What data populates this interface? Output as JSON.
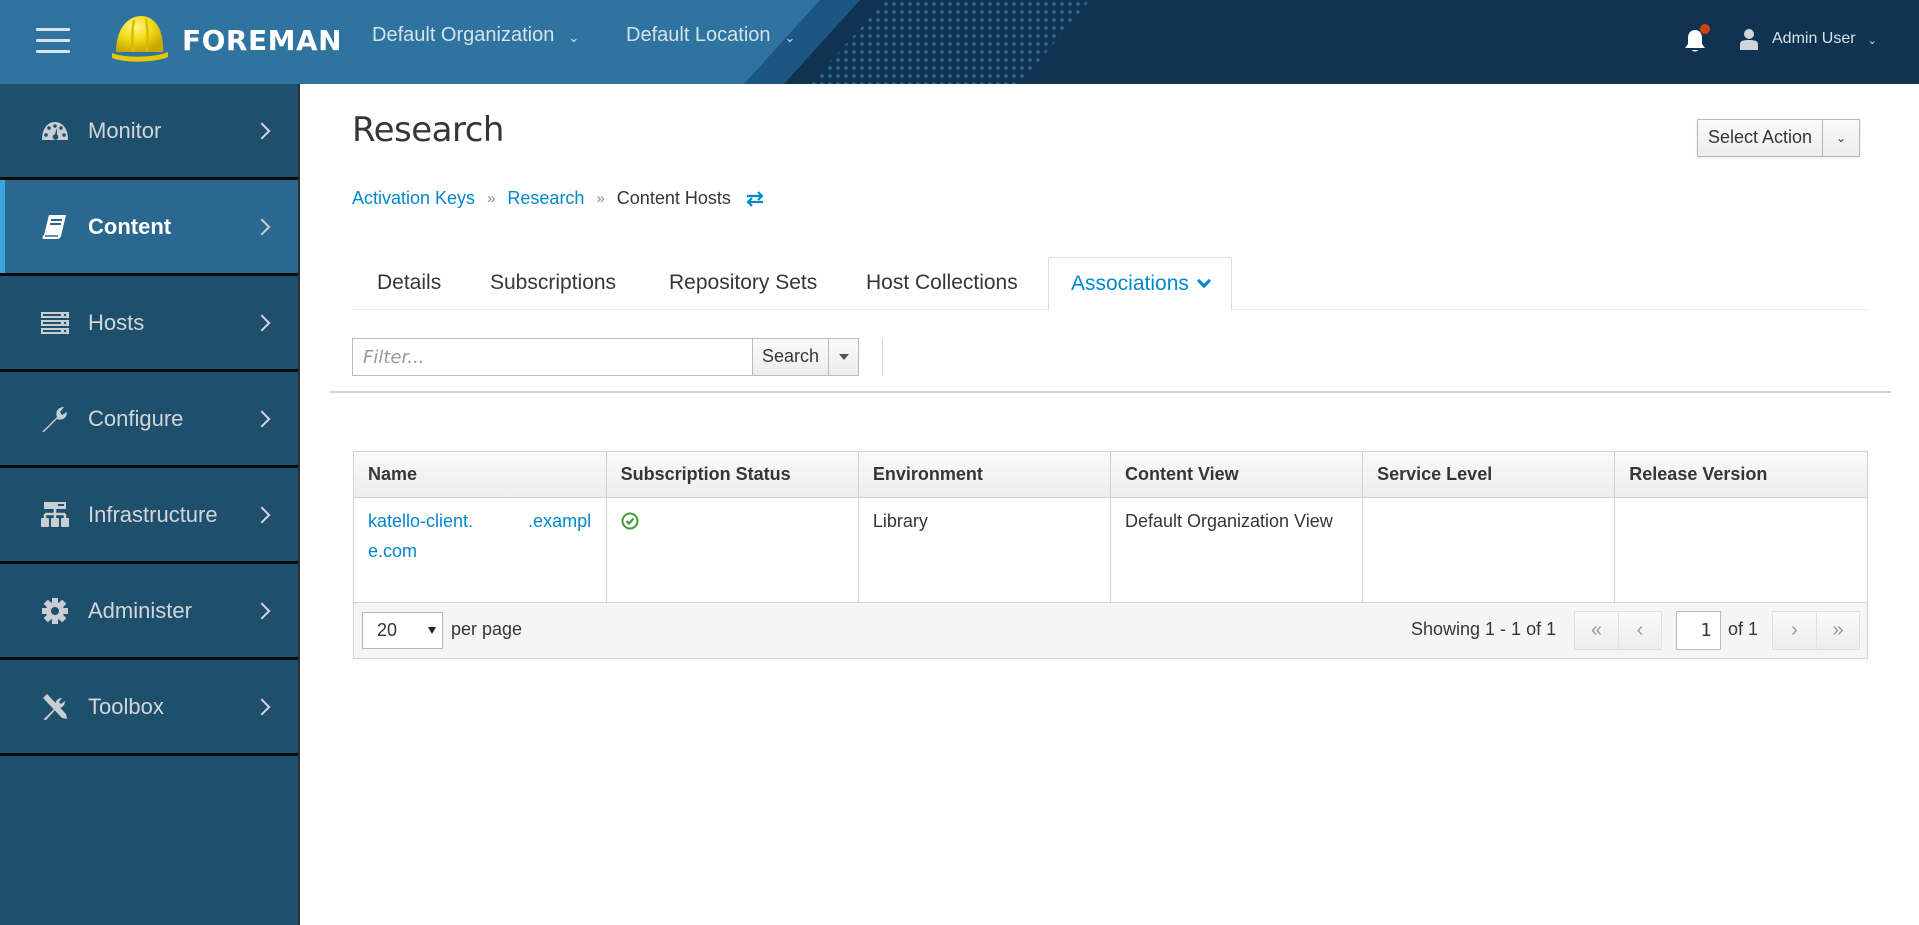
{
  "header": {
    "brand": "FOREMAN",
    "organization": "Default Organization",
    "location": "Default Location",
    "user": "Admin User",
    "notification_badge_color": "#d0450d"
  },
  "sidebar": {
    "items": [
      {
        "label": "Monitor",
        "icon": "dashboard-icon",
        "active": false
      },
      {
        "label": "Content",
        "icon": "book-icon",
        "active": true
      },
      {
        "label": "Hosts",
        "icon": "server-icon",
        "active": false
      },
      {
        "label": "Configure",
        "icon": "wrench-icon",
        "active": false
      },
      {
        "label": "Infrastructure",
        "icon": "network-icon",
        "active": false
      },
      {
        "label": "Administer",
        "icon": "gear-icon",
        "active": false
      },
      {
        "label": "Toolbox",
        "icon": "tools-icon",
        "active": false
      }
    ]
  },
  "page": {
    "title": "Research",
    "select_action": "Select Action",
    "breadcrumb": [
      {
        "label": "Activation Keys",
        "link": true
      },
      {
        "label": "Research",
        "link": true
      },
      {
        "label": "Content Hosts",
        "link": false
      }
    ],
    "tabs": [
      {
        "label": "Details",
        "active": false
      },
      {
        "label": "Subscriptions",
        "active": false
      },
      {
        "label": "Repository Sets",
        "active": false
      },
      {
        "label": "Host Collections",
        "active": false
      },
      {
        "label": "Associations",
        "active": true
      }
    ]
  },
  "search": {
    "placeholder": "Filter...",
    "value": "",
    "button": "Search"
  },
  "table": {
    "columns": [
      "Name",
      "Subscription Status",
      "Environment",
      "Content View",
      "Service Level",
      "Release Version"
    ],
    "rows": [
      {
        "name": "katello-client.           .example.com",
        "subscription_status": "valid",
        "environment": "Library",
        "content_view": "Default Organization View",
        "service_level": "",
        "release_version": ""
      }
    ]
  },
  "pagination": {
    "per_page": "20",
    "per_page_label": "per page",
    "showing": "Showing 1 - 1 of 1",
    "current_page": "1",
    "of_pages": "of 1",
    "first": "«",
    "prev": "‹",
    "next": "›",
    "last": "»"
  },
  "colors": {
    "link": "#0088ce",
    "status_ok": "#3f9c35",
    "sidebar_bg": "#1e4f6d",
    "sidebar_active": "#2a6891",
    "header_bg": "#0f3350"
  }
}
